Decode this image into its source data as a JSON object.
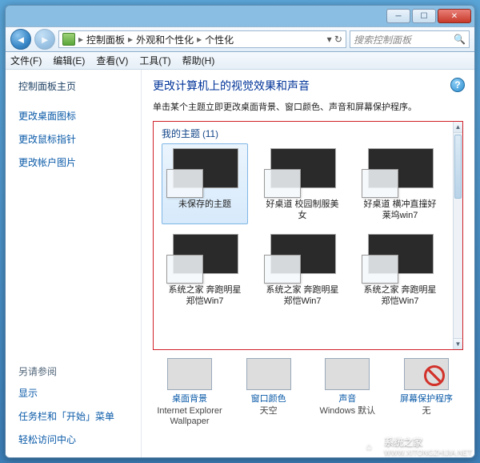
{
  "breadcrumb": {
    "root": "控制面板",
    "mid": "外观和个性化",
    "leaf": "个性化"
  },
  "search": {
    "placeholder": "搜索控制面板"
  },
  "menu": {
    "file": "文件(F)",
    "edit": "编辑(E)",
    "view": "查看(V)",
    "tools": "工具(T)",
    "help": "帮助(H)"
  },
  "sidebar": {
    "home": "控制面板主页",
    "links": [
      "更改桌面图标",
      "更改鼠标指针",
      "更改帐户图片"
    ],
    "see_also": "另请参阅",
    "see_links": [
      "显示",
      "任务栏和「开始」菜单",
      "轻松访问中心"
    ]
  },
  "heading": "更改计算机上的视觉效果和声音",
  "subheading": "单击某个主题立即更改桌面背景、窗口颜色、声音和屏幕保护程序。",
  "themes_section": {
    "label": "我的主题",
    "count": 11
  },
  "themes": [
    {
      "name": "未保存的主题",
      "bg": "bg-land",
      "selected": true
    },
    {
      "name": "好桌道 校园制服美女",
      "bg": "bg-black"
    },
    {
      "name": "好桌道 横冲直撞好莱坞win7",
      "bg": "bg-black"
    },
    {
      "name": "系统之家 奔跑明星郑恺Win7",
      "bg": "bg-run"
    },
    {
      "name": "系统之家 奔跑明星郑恺Win7",
      "bg": "bg-run"
    },
    {
      "name": "系统之家 奔跑明星郑恺Win7",
      "bg": "bg-run"
    }
  ],
  "bottom": [
    {
      "link": "桌面背景",
      "value": "Internet Explorer Wallpaper",
      "ic": "bg-land"
    },
    {
      "link": "窗口颜色",
      "value": "天空",
      "ic": "ic-win"
    },
    {
      "link": "声音",
      "value": "Windows 默认",
      "ic": "ic-snd"
    },
    {
      "link": "屏幕保护程序",
      "value": "无",
      "ic": "ic-no"
    }
  ],
  "watermark": {
    "text": "系统之家",
    "url": "WWW.XITONGZHIJIA.NET"
  }
}
